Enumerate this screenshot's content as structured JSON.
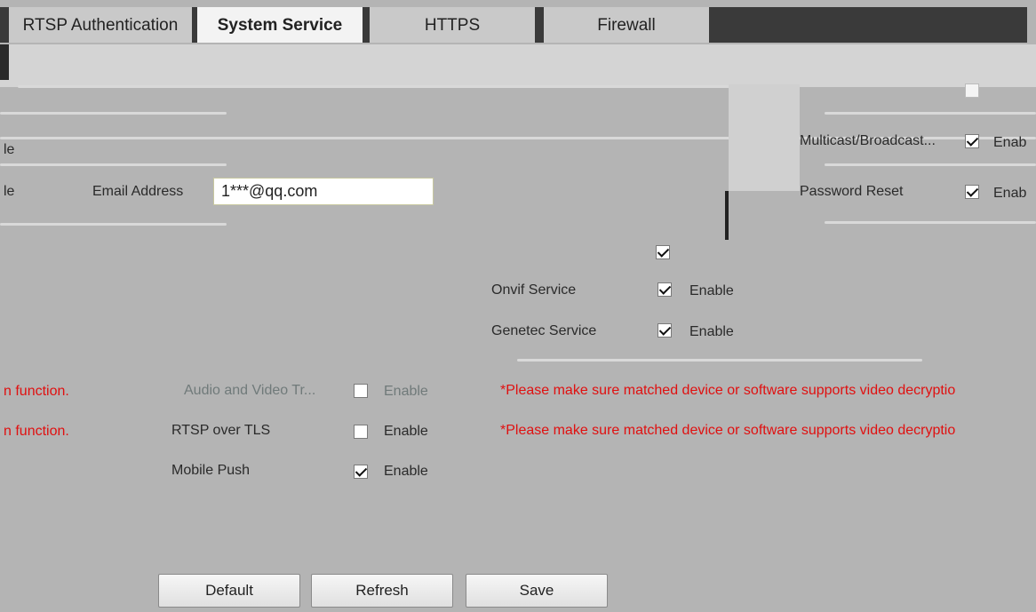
{
  "tabs": {
    "rtsp_auth": "RTSP Authentication",
    "system_service": "System Service",
    "https": "HTTPS",
    "firewall": "Firewall"
  },
  "left_partial": {
    "row1": "le",
    "row2": "le",
    "notice1": "n function.",
    "notice2": "n function."
  },
  "email": {
    "label": "Email Address",
    "value": "1***@qq.com"
  },
  "right_top": {
    "multicast_label": "Multicast/Broadcast...",
    "multicast_enable": "Enab",
    "password_reset_label": "Password Reset",
    "password_reset_enable": "Enab"
  },
  "services": {
    "onvif_label": "Onvif Service",
    "onvif_enable": "Enable",
    "genetec_label": "Genetec Service",
    "genetec_enable": "Enable"
  },
  "transmission": {
    "av_label": "Audio and Video Tr...",
    "av_enable": "Enable",
    "rtsp_tls_label": "RTSP over TLS",
    "rtsp_tls_enable": "Enable",
    "mobile_push_label": "Mobile Push",
    "mobile_push_enable": "Enable",
    "warning1": "*Please make sure matched device or software supports video decryptio",
    "warning2": "*Please make sure matched device or software supports video decryptio"
  },
  "buttons": {
    "default": "Default",
    "refresh": "Refresh",
    "save": "Save"
  },
  "colors": {
    "warning": "#e01010",
    "background": "#b4b4b4"
  }
}
